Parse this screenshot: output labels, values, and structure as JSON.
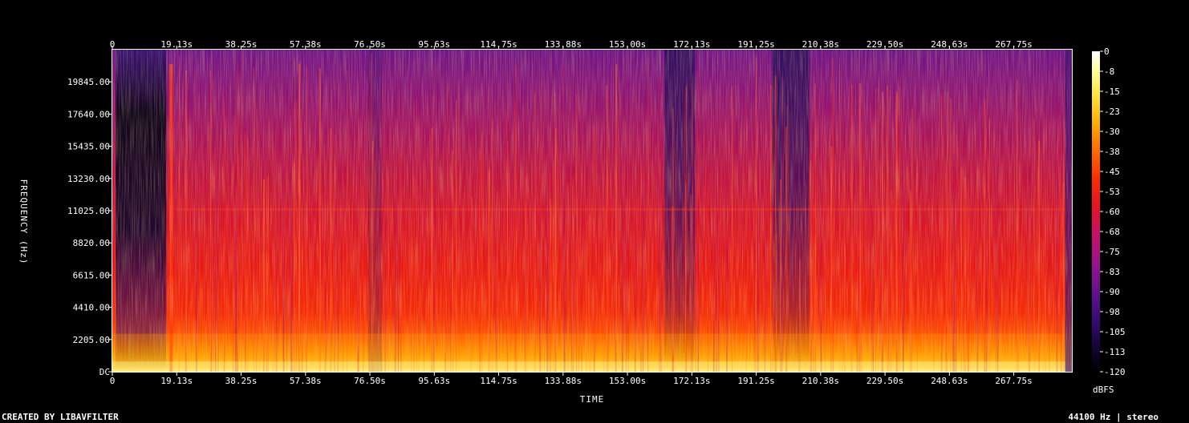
{
  "chart_data": {
    "type": "heatmap",
    "title": "",
    "xlabel": "TIME",
    "ylabel": "FREQUENCY (Hz)",
    "x_ticks": [
      "0",
      "19.13s",
      "38.25s",
      "57.38s",
      "76.50s",
      "95.63s",
      "114.75s",
      "133.88s",
      "153.00s",
      "172.13s",
      "191.25s",
      "210.38s",
      "229.50s",
      "248.63s",
      "267.75s"
    ],
    "x_tick_values": [
      0,
      19.13,
      38.25,
      57.38,
      76.5,
      95.63,
      114.75,
      133.88,
      153.0,
      172.13,
      191.25,
      210.38,
      229.5,
      248.63,
      267.75
    ],
    "xlim": [
      0,
      285
    ],
    "y_ticks": [
      "DC",
      "2205.00",
      "4410.00",
      "6615.00",
      "8820.00",
      "11025.00",
      "13230.00",
      "15435.00",
      "17640.00",
      "19845.00"
    ],
    "y_tick_values": [
      0,
      2205,
      4410,
      6615,
      8820,
      11025,
      13230,
      15435,
      17640,
      19845
    ],
    "ylim": [
      0,
      22050
    ],
    "colorbar": {
      "label": "dBFS",
      "ticks": [
        "0",
        "-8",
        "-15",
        "-23",
        "-30",
        "-38",
        "-45",
        "-53",
        "-60",
        "-68",
        "-75",
        "-83",
        "-90",
        "-98",
        "-105",
        "-113",
        "-120"
      ],
      "range": [
        -120,
        0
      ],
      "colormap": [
        "#000000",
        "#1a0033",
        "#3d0a6b",
        "#6a1291",
        "#a3148f",
        "#d5116b",
        "#f0152f",
        "#ff3d00",
        "#ff7a00",
        "#ffb800",
        "#ffe040",
        "#ffffa0",
        "#ffffff"
      ]
    },
    "loud_regions_seconds": [
      [
        17,
        19,
        "spike"
      ],
      [
        76,
        80,
        "dip"
      ],
      [
        164,
        173,
        "quiet-top"
      ],
      [
        196,
        207,
        "quiet-top"
      ]
    ],
    "legend": "none",
    "grid": false
  },
  "footer": {
    "left": "CREATED BY LIBAVFILTER",
    "right": "44100 Hz | stereo"
  }
}
